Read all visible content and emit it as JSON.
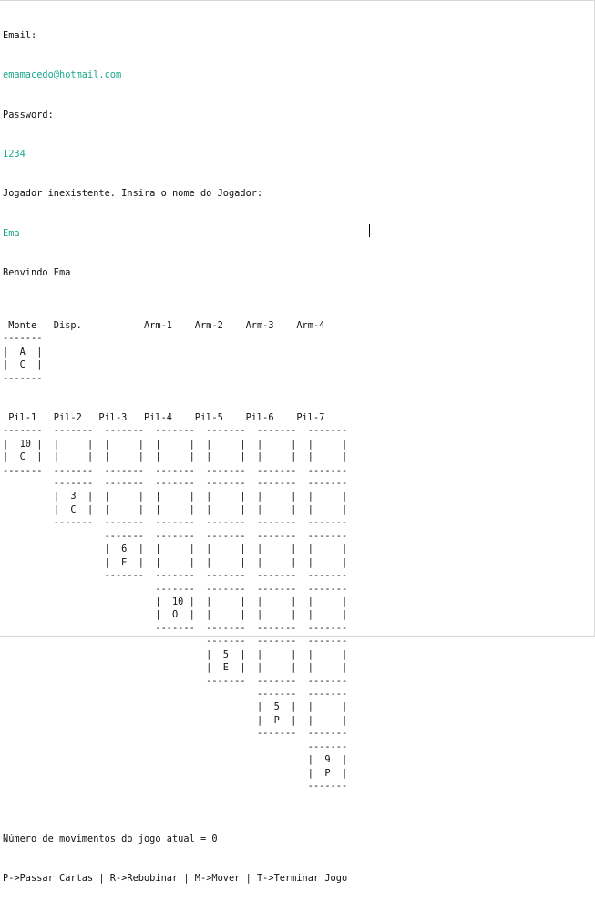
{
  "colors": {
    "background": "#ffffff",
    "text": "#111111",
    "user_input": "#1aa88a"
  },
  "login": {
    "email_label": "Email:",
    "email_value": "emamacedo@hotmail.com",
    "password_label": "Password:",
    "password_value": "1234",
    "player_prompt": "Jogador inexistente. Insira o nome do Jogador:",
    "player_value": "Ema",
    "welcome": "Benvindo Ema"
  },
  "board_lines": [
    "",
    " Monte   Disp.           Arm-1    Arm-2    Arm-3    Arm-4",
    "-------",
    "|  A  |",
    "|  C  |",
    "-------",
    "",
    "",
    " Pil-1   Pil-2   Pil-3   Pil-4    Pil-5    Pil-6    Pil-7",
    "-------  -------  -------  -------  -------  -------  -------",
    "|  10 |  |     |  |     |  |     |  |     |  |     |  |     |",
    "|  C  |  |     |  |     |  |     |  |     |  |     |  |     |",
    "-------  -------  -------  -------  -------  -------  -------",
    "         -------  -------  -------  -------  -------  -------",
    "         |  3  |  |     |  |     |  |     |  |     |  |     |",
    "         |  C  |  |     |  |     |  |     |  |     |  |     |",
    "         -------  -------  -------  -------  -------  -------",
    "                  -------  -------  -------  -------  -------",
    "                  |  6  |  |     |  |     |  |     |  |     |",
    "                  |  E  |  |     |  |     |  |     |  |     |",
    "                  -------  -------  -------  -------  -------",
    "                           -------  -------  -------  -------",
    "                           |  10 |  |     |  |     |  |     |",
    "                           |  O  |  |     |  |     |  |     |",
    "                           -------  -------  -------  -------",
    "                                    -------  -------  -------",
    "                                    |  5  |  |     |  |     |",
    "                                    |  E  |  |     |  |     |",
    "                                    -------  -------  -------",
    "                                             -------  -------",
    "                                             |  5  |  |     |",
    "                                             |  P  |  |     |",
    "                                             -------  -------",
    "                                                      -------",
    "                                                      |  9  |",
    "                                                      |  P  |",
    "                                                      -------",
    ""
  ],
  "status": {
    "moves": "Número de movimentos do jogo atual = 0",
    "menu": "P->Passar Cartas | R->Rebobinar | M->Mover | T->Terminar Jogo"
  }
}
